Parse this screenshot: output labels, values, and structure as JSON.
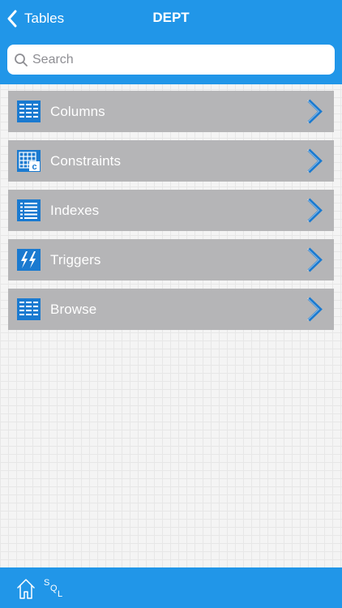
{
  "nav": {
    "back_label": "Tables",
    "title": "DEPT"
  },
  "search": {
    "placeholder": "Search",
    "value": ""
  },
  "menu": {
    "items": [
      {
        "label": "Columns",
        "icon": "columns-grid-icon"
      },
      {
        "label": "Constraints",
        "icon": "constraints-table-icon"
      },
      {
        "label": "Indexes",
        "icon": "indexes-list-icon"
      },
      {
        "label": "Triggers",
        "icon": "triggers-lightning-icon"
      },
      {
        "label": "Browse",
        "icon": "browse-grid-icon"
      }
    ]
  },
  "toolbar": {
    "home_icon": "home-icon",
    "sql_letters": [
      "S",
      "Q",
      "L"
    ]
  },
  "colors": {
    "accent": "#2196e8",
    "menu_item_bg": "#b5b5b7",
    "icon_blue": "#1a7ad0",
    "background": "#f4f4f4"
  }
}
